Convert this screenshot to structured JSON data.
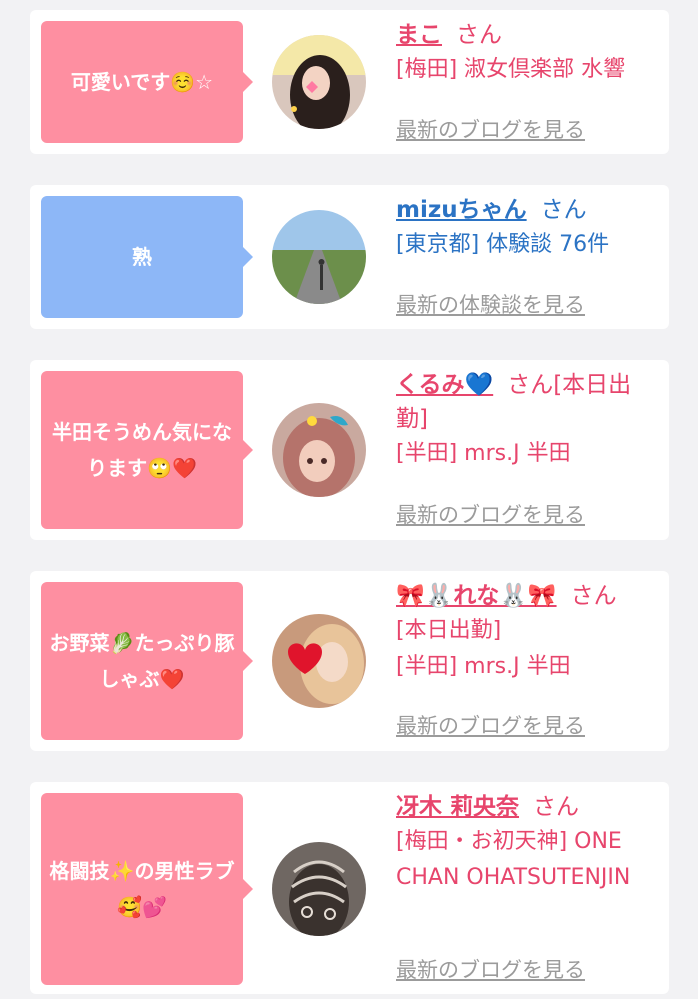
{
  "entries": [
    {
      "comment": "可愛いです☺️☆",
      "name": "まこ",
      "suffix": "さん",
      "details": [
        "[梅田] 淑女倶楽部 水響"
      ],
      "link": "最新のブログを見る",
      "color": "#fe8fa1",
      "avatar_icon": "girl-photo-icon"
    },
    {
      "comment": "熟",
      "name": "mizuちゃん",
      "suffix": "さん",
      "details": [
        "[東京都] 体験談 76件"
      ],
      "link": "最新の体験談を見る",
      "color": "#8db7f7",
      "avatar_icon": "road-landscape-icon"
    },
    {
      "comment": "半田そうめん気になります🙄❤️",
      "name": "くるみ💙",
      "suffix": "さん[本日出勤]",
      "details": [
        "[半田] mrs.J 半田"
      ],
      "link": "最新のブログを見る",
      "color": "#fe8fa1",
      "avatar_icon": "girl-photo-icon"
    },
    {
      "comment": "お野菜🥬たっぷり豚しゃぶ❤️",
      "name": "🎀🐰れな🐰🎀",
      "suffix": "さん",
      "details": [
        "[本日出勤]",
        "[半田] mrs.J 半田"
      ],
      "link": "最新のブログを見る",
      "color": "#fe8fa1",
      "avatar_icon": "heart-photo-icon"
    },
    {
      "comment": "格闘技✨の男性ラブ🥰💕",
      "name": "冴木 莉央奈",
      "suffix": "さん",
      "details": [
        "[梅田・お初天神] ONE CHAN OHATSUTENJIN"
      ],
      "link": "最新のブログを見る",
      "color": "#fe8fa1",
      "avatar_icon": "lace-photo-icon"
    }
  ]
}
